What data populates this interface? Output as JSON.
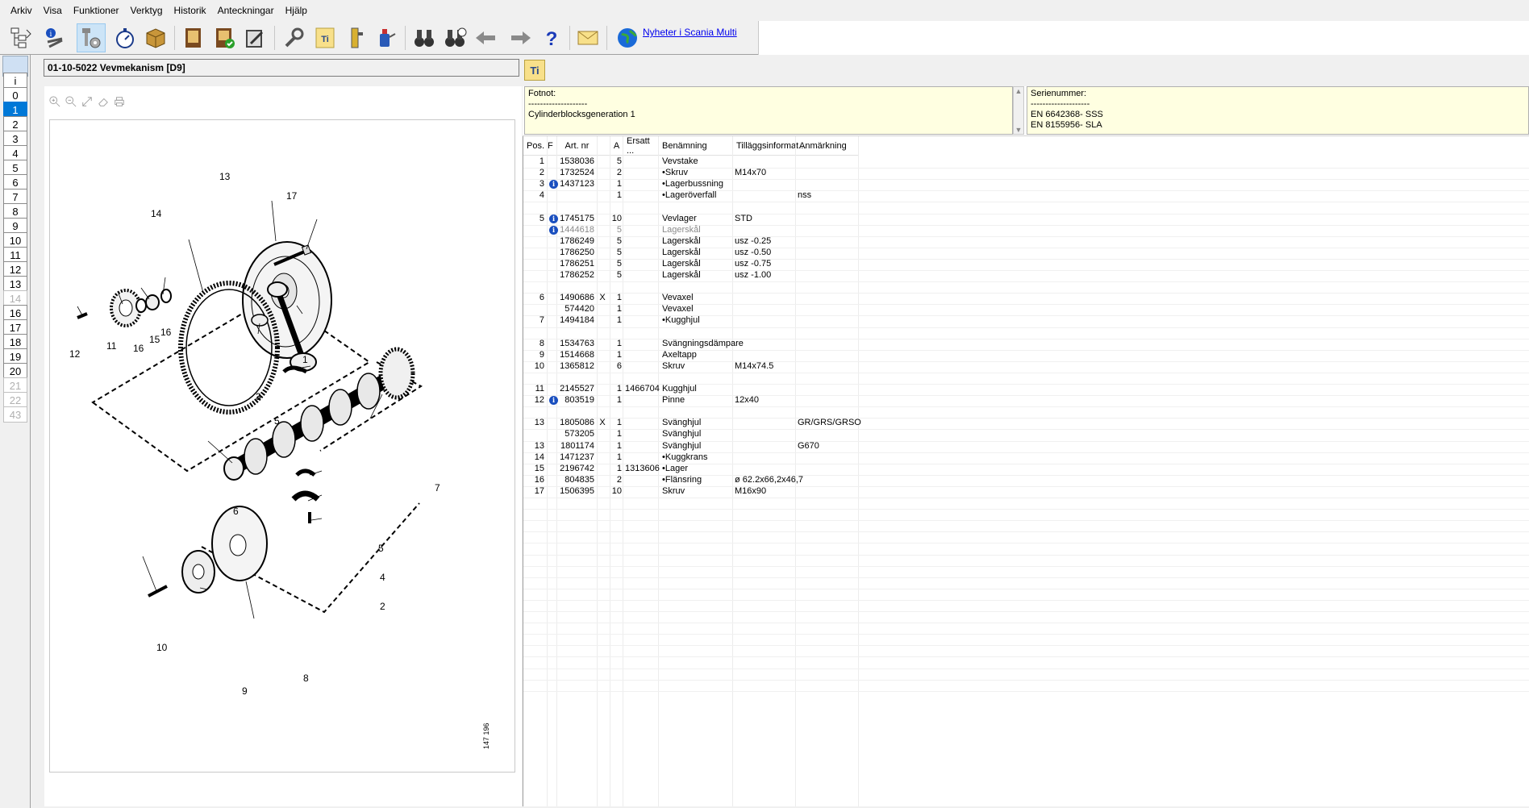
{
  "menu": [
    "Arkiv",
    "Visa",
    "Funktioner",
    "Verktyg",
    "Historik",
    "Anteckningar",
    "Hjälp"
  ],
  "toolbar": {
    "icons": [
      "tree-view-icon",
      "info-tools-icon",
      "bolt-parts-icon",
      "stopwatch-icon",
      "package-icon",
      "book-icon",
      "book-check-icon",
      "notepad-icon",
      "wrench-icon",
      "ti-document-icon",
      "service-tool-icon",
      "oil-can-icon",
      "binoculars-icon",
      "binoculars-history-icon",
      "arrow-left-icon",
      "arrow-right-icon",
      "help-icon",
      "envelope-icon",
      "globe-icon"
    ],
    "news_link": "Nyheter i Scania Multi"
  },
  "sidebar": {
    "items": [
      {
        "label": "i",
        "state": "normal"
      },
      {
        "label": "0",
        "state": "normal"
      },
      {
        "label": "1",
        "state": "selected"
      },
      {
        "label": "2",
        "state": "normal"
      },
      {
        "label": "3",
        "state": "normal"
      },
      {
        "label": "4",
        "state": "normal"
      },
      {
        "label": "5",
        "state": "normal"
      },
      {
        "label": "6",
        "state": "normal"
      },
      {
        "label": "7",
        "state": "normal"
      },
      {
        "label": "8",
        "state": "normal"
      },
      {
        "label": "9",
        "state": "normal"
      },
      {
        "label": "10",
        "state": "normal"
      },
      {
        "label": "11",
        "state": "normal"
      },
      {
        "label": "12",
        "state": "normal"
      },
      {
        "label": "13",
        "state": "normal"
      },
      {
        "label": "14",
        "state": "disabled"
      },
      {
        "label": "16",
        "state": "normal"
      },
      {
        "label": "17",
        "state": "normal"
      },
      {
        "label": "18",
        "state": "normal"
      },
      {
        "label": "19",
        "state": "normal"
      },
      {
        "label": "20",
        "state": "normal"
      },
      {
        "label": "21",
        "state": "disabled"
      },
      {
        "label": "22",
        "state": "disabled"
      },
      {
        "label": "43",
        "state": "disabled"
      }
    ]
  },
  "header": {
    "title": "01-10-5022 Vevmekanism [D9]",
    "ti_label": "Ti"
  },
  "drawing": {
    "callouts": [
      "13",
      "17",
      "14",
      "16",
      "15",
      "11",
      "16",
      "12",
      "1",
      "3",
      "5",
      "7",
      "6",
      "5",
      "4",
      "2",
      "10",
      "9",
      "8"
    ],
    "stamp": "147 196"
  },
  "fotnot": {
    "label": "Fotnot:",
    "separator": "--------------------",
    "text": "Cylinderblocksgeneration 1"
  },
  "serienummer": {
    "label": "Serienummer:",
    "separator": "--------------------",
    "lines": [
      "EN 6642368- SSS",
      "EN 8155956- SLA"
    ]
  },
  "grid": {
    "columns": [
      "Pos.",
      "F",
      "Art. nr",
      "",
      "A",
      "Ersatt ...",
      "Benämning",
      "Tilläggsinformat...",
      "Anmärkning"
    ],
    "rows": [
      {
        "pos": "1",
        "info": false,
        "art": "1538036",
        "x": "",
        "a": "5",
        "ersatt": "",
        "ben": "Vevstake",
        "till": "",
        "anm": "",
        "dim": false
      },
      {
        "pos": "2",
        "info": false,
        "art": "1732524",
        "x": "",
        "a": "2",
        "ersatt": "",
        "ben": "•Skruv",
        "till": "M14x70",
        "anm": "",
        "dim": false
      },
      {
        "pos": "3",
        "info": true,
        "art": "1437123",
        "x": "",
        "a": "1",
        "ersatt": "",
        "ben": "•Lagerbussning",
        "till": "",
        "anm": "",
        "dim": false
      },
      {
        "pos": "4",
        "info": false,
        "art": "",
        "x": "",
        "a": "1",
        "ersatt": "",
        "ben": "•Lageröverfall",
        "till": "",
        "anm": "nss",
        "dim": false
      },
      {
        "pos": "",
        "info": false,
        "art": "",
        "x": "",
        "a": "",
        "ersatt": "",
        "ben": "",
        "till": "",
        "anm": "",
        "dim": false
      },
      {
        "pos": "5",
        "info": true,
        "art": "1745175",
        "x": "",
        "a": "10",
        "ersatt": "",
        "ben": "Vevlager",
        "till": "STD",
        "anm": "",
        "dim": false
      },
      {
        "pos": "",
        "info": true,
        "art": "1444618",
        "x": "",
        "a": "5",
        "ersatt": "",
        "ben": "Lagerskål",
        "till": "",
        "anm": "",
        "dim": true
      },
      {
        "pos": "",
        "info": false,
        "art": "1786249",
        "x": "",
        "a": "5",
        "ersatt": "",
        "ben": "Lagerskål",
        "till": "usz -0.25",
        "anm": "",
        "dim": false
      },
      {
        "pos": "",
        "info": false,
        "art": "1786250",
        "x": "",
        "a": "5",
        "ersatt": "",
        "ben": "Lagerskål",
        "till": "usz -0.50",
        "anm": "",
        "dim": false
      },
      {
        "pos": "",
        "info": false,
        "art": "1786251",
        "x": "",
        "a": "5",
        "ersatt": "",
        "ben": "Lagerskål",
        "till": "usz -0.75",
        "anm": "",
        "dim": false
      },
      {
        "pos": "",
        "info": false,
        "art": "1786252",
        "x": "",
        "a": "5",
        "ersatt": "",
        "ben": "Lagerskål",
        "till": "usz -1.00",
        "anm": "",
        "dim": false
      },
      {
        "pos": "",
        "info": false,
        "art": "",
        "x": "",
        "a": "",
        "ersatt": "",
        "ben": "",
        "till": "",
        "anm": "",
        "dim": false
      },
      {
        "pos": "6",
        "info": false,
        "art": "1490686",
        "x": "X",
        "a": "1",
        "ersatt": "",
        "ben": "Vevaxel",
        "till": "",
        "anm": "",
        "dim": false
      },
      {
        "pos": "",
        "info": false,
        "art": "574420",
        "x": "",
        "a": "1",
        "ersatt": "",
        "ben": "Vevaxel",
        "till": "",
        "anm": "",
        "dim": false
      },
      {
        "pos": "7",
        "info": false,
        "art": "1494184",
        "x": "",
        "a": "1",
        "ersatt": "",
        "ben": "•Kugghjul",
        "till": "",
        "anm": "",
        "dim": false
      },
      {
        "pos": "",
        "info": false,
        "art": "",
        "x": "",
        "a": "",
        "ersatt": "",
        "ben": "",
        "till": "",
        "anm": "",
        "dim": false
      },
      {
        "pos": "8",
        "info": false,
        "art": "1534763",
        "x": "",
        "a": "1",
        "ersatt": "",
        "ben": "Svängningsdämpare",
        "till": "",
        "anm": "",
        "dim": false
      },
      {
        "pos": "9",
        "info": false,
        "art": "1514668",
        "x": "",
        "a": "1",
        "ersatt": "",
        "ben": "Axeltapp",
        "till": "",
        "anm": "",
        "dim": false
      },
      {
        "pos": "10",
        "info": false,
        "art": "1365812",
        "x": "",
        "a": "6",
        "ersatt": "",
        "ben": "Skruv",
        "till": "M14x74.5",
        "anm": "",
        "dim": false
      },
      {
        "pos": "",
        "info": false,
        "art": "",
        "x": "",
        "a": "",
        "ersatt": "",
        "ben": "",
        "till": "",
        "anm": "",
        "dim": false
      },
      {
        "pos": "11",
        "info": false,
        "art": "2145527",
        "x": "",
        "a": "1",
        "ersatt": "1466704",
        "ben": "Kugghjul",
        "till": "",
        "anm": "",
        "dim": false
      },
      {
        "pos": "12",
        "info": true,
        "art": "803519",
        "x": "",
        "a": "1",
        "ersatt": "",
        "ben": "Pinne",
        "till": "12x40",
        "anm": "",
        "dim": false
      },
      {
        "pos": "",
        "info": false,
        "art": "",
        "x": "",
        "a": "",
        "ersatt": "",
        "ben": "",
        "till": "",
        "anm": "",
        "dim": false
      },
      {
        "pos": "13",
        "info": false,
        "art": "1805086",
        "x": "X",
        "a": "1",
        "ersatt": "",
        "ben": "Svänghjul",
        "till": "",
        "anm": "GR/GRS/GRSO",
        "dim": false
      },
      {
        "pos": "",
        "info": false,
        "art": "573205",
        "x": "",
        "a": "1",
        "ersatt": "",
        "ben": "Svänghjul",
        "till": "",
        "anm": "",
        "dim": false
      },
      {
        "pos": "13",
        "info": false,
        "art": "1801174",
        "x": "",
        "a": "1",
        "ersatt": "",
        "ben": "Svänghjul",
        "till": "",
        "anm": "G670",
        "dim": false
      },
      {
        "pos": "14",
        "info": false,
        "art": "1471237",
        "x": "",
        "a": "1",
        "ersatt": "",
        "ben": "•Kuggkrans",
        "till": "",
        "anm": "",
        "dim": false
      },
      {
        "pos": "15",
        "info": false,
        "art": "2196742",
        "x": "",
        "a": "1",
        "ersatt": "1313606",
        "ben": "•Lager",
        "till": "",
        "anm": "",
        "dim": false
      },
      {
        "pos": "16",
        "info": false,
        "art": "804835",
        "x": "",
        "a": "2",
        "ersatt": "",
        "ben": "•Flänsring",
        "till": "ø 62.2x66,2x46,7",
        "anm": "",
        "dim": false
      },
      {
        "pos": "17",
        "info": false,
        "art": "1506395",
        "x": "",
        "a": "10",
        "ersatt": "",
        "ben": "Skruv",
        "till": "M16x90",
        "anm": "",
        "dim": false
      }
    ]
  }
}
